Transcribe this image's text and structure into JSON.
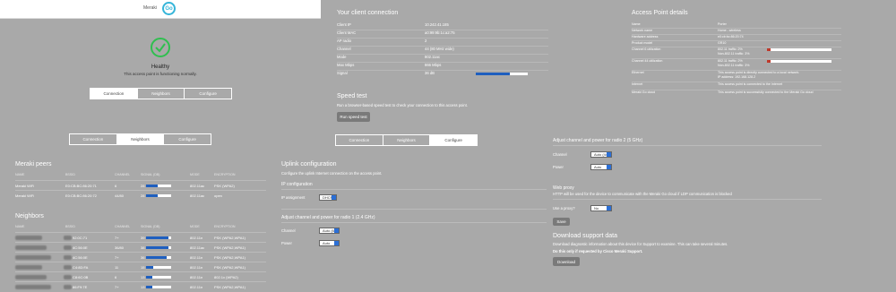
{
  "header": {
    "brand": "Meraki",
    "logo_text": "Go"
  },
  "health": {
    "title": "Healthy",
    "subtitle": "This access point is functioning normally."
  },
  "tabs": [
    "Connection",
    "Neighbors",
    "Configure"
  ],
  "client": {
    "title": "Your client connection",
    "rows": [
      {
        "k": "Client IP",
        "v": "10.242.41.185"
      },
      {
        "k": "Client MAC",
        "v": "a0:99:9b:1c:a2:75"
      },
      {
        "k": "AP radio",
        "v": "2"
      },
      {
        "k": "Channel",
        "v": "44 (80 MHz wide)"
      },
      {
        "k": "Mode",
        "v": "802.11ac"
      },
      {
        "k": "Max Mbps",
        "v": "866 Mbps"
      },
      {
        "k": "Signal",
        "v": "36 dB",
        "level": 0.65
      }
    ]
  },
  "apdetails": {
    "title": "Access Point details",
    "rows": [
      {
        "k": "Name",
        "v": "Porter"
      },
      {
        "k": "Network name",
        "v": "Home - wireless"
      },
      {
        "k": "Hardware address",
        "v": "e0:cb:bc:86:20:74"
      },
      {
        "k": "Product model",
        "v": "GR10"
      },
      {
        "k": "Channel 6 utilization",
        "v": "802.11 traffic: 2%\nNon-802.11 traffic: 3%",
        "level": 0.05
      },
      {
        "k": "Channel 44 utilization",
        "v": "802.11 traffic: 2%\nNon-802.11 traffic: 3%",
        "level": 0.05
      },
      {
        "k": "Ethernet",
        "v": "This access point is directly connected to a local network.\nIP address: 192.168.128.2"
      },
      {
        "k": "Internet",
        "v": "This access point is connected to the Internet"
      },
      {
        "k": "Meraki Go cloud",
        "v": "This access point is successfully connected to the Meraki Go cloud"
      }
    ]
  },
  "speedtest": {
    "title": "Speed test",
    "desc": "Run a browser-based speed test to check your connection to this access point.",
    "button": "Run speed test"
  },
  "neighbors": {
    "peers_title": "Meraki peers",
    "headers": [
      "NAME",
      "BSSID",
      "CHANNEL",
      "SIGNAL (DB)",
      "MODE",
      "ENCRYPTION"
    ],
    "peers": [
      {
        "name": "Meraki WiFi",
        "bssid": "E0:CB:BC:86:20:71",
        "channel": "6",
        "signal": "28",
        "level": 0.45,
        "mode": "802.11ac",
        "enc": "PSK (WPA2)"
      },
      {
        "name": "Meraki WiFi",
        "bssid": "E0:CB:BC:86:20:72",
        "channel": "44/80",
        "signal": "28",
        "level": 0.45,
        "mode": "802.11ac",
        "enc": "open"
      }
    ],
    "neighbors_title": "Neighbors",
    "rows": [
      {
        "bssid": "92:0C:71",
        "channel": "7+",
        "signal": "39",
        "level": 0.9,
        "mode": "802.11n",
        "enc": "PSK (WPA2,WPA1)"
      },
      {
        "bssid": "4C:56:0E",
        "channel": "36/80",
        "signal": "38",
        "level": 0.88,
        "mode": "802.11ac",
        "enc": "PSK (WPA2,WPA1)"
      },
      {
        "bssid": "4C:56:0E",
        "channel": "7+",
        "signal": "36",
        "level": 0.82,
        "mode": "802.11n",
        "enc": "PSK (WPA2,WPA1)"
      },
      {
        "bssid": "C4:8D:FA",
        "channel": "11",
        "signal": "15",
        "level": 0.3,
        "mode": "802.11n",
        "enc": "PSK (WPA2,WPA1)"
      },
      {
        "bssid": "C8:6C:0B",
        "channel": "6",
        "signal": "13",
        "level": 0.25,
        "mode": "802.11n",
        "enc": "802.1x (WPA2)"
      },
      {
        "bssid": "86:F9:7E",
        "channel": "7+",
        "signal": "13",
        "level": 0.25,
        "mode": "802.11n",
        "enc": "PSK (WPA2,WPA1)"
      }
    ]
  },
  "configure": {
    "uplink_title": "Uplink configuration",
    "uplink_desc": "Configure the uplink Internet connection on the access point.",
    "ip_config": "IP configuration",
    "ip_label": "IP assignment",
    "ip_value": "DHCP",
    "radio1_title": "Adjust channel and power for radio 1 (2.4 GHz)",
    "radio2_title": "Adjust channel and power for radio 2 (5 GHz)",
    "channel_label": "Channel",
    "power_label": "Power",
    "r1_channel": "Auto (6)",
    "r1_power": "Auto",
    "r2_channel": "Auto (44)",
    "r2_power": "Auto",
    "proxy_title": "Web proxy",
    "proxy_desc": "HTTP will be used for the device to communicate with the Meraki Go cloud if LDP communication is blocked",
    "proxy_label": "Use a proxy?",
    "proxy_value": "No",
    "save": "Save",
    "support_title": "Download support data",
    "support_desc": "Download diagnostic information about this device for Support to examine. This can take several minutes.",
    "support_note": "Do this only if requested by Cisco Meraki Support.",
    "download": "Download"
  }
}
